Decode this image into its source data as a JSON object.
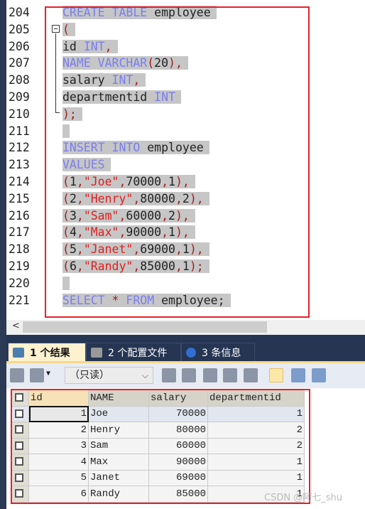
{
  "editor": {
    "lines": [
      {
        "n": "204",
        "tokens": [
          [
            "kw",
            "CREATE TABLE"
          ],
          [
            "tx",
            " employee"
          ]
        ]
      },
      {
        "n": "205",
        "tokens": [
          [
            "pn",
            "("
          ]
        ]
      },
      {
        "n": "206",
        "tokens": [
          [
            "tx",
            "id "
          ],
          [
            "kw",
            "INT"
          ],
          [
            "pn",
            ","
          ]
        ]
      },
      {
        "n": "207",
        "tokens": [
          [
            "kw",
            "NAME VARCHAR"
          ],
          [
            "pn",
            "("
          ],
          [
            "tx",
            "20"
          ],
          [
            "pn",
            "),"
          ]
        ]
      },
      {
        "n": "208",
        "tokens": [
          [
            "tx",
            "salary "
          ],
          [
            "kw",
            "INT"
          ],
          [
            "pn",
            ","
          ]
        ]
      },
      {
        "n": "209",
        "tokens": [
          [
            "tx",
            "departmentid "
          ],
          [
            "kw",
            "INT"
          ]
        ]
      },
      {
        "n": "210",
        "tokens": [
          [
            "pn",
            ");"
          ]
        ]
      },
      {
        "n": "211",
        "tokens": []
      },
      {
        "n": "212",
        "tokens": [
          [
            "kw",
            "INSERT INTO"
          ],
          [
            "tx",
            " employee"
          ]
        ]
      },
      {
        "n": "213",
        "tokens": [
          [
            "kw",
            "VALUES"
          ]
        ]
      },
      {
        "n": "214",
        "tokens": [
          [
            "pn",
            "("
          ],
          [
            "tx",
            "1"
          ],
          [
            "pn",
            ","
          ],
          [
            "str",
            "\"Joe\""
          ],
          [
            "pn",
            ","
          ],
          [
            "tx",
            "70000"
          ],
          [
            "pn",
            ","
          ],
          [
            "tx",
            "1"
          ],
          [
            "pn",
            "),"
          ]
        ]
      },
      {
        "n": "215",
        "tokens": [
          [
            "pn",
            "("
          ],
          [
            "tx",
            "2"
          ],
          [
            "pn",
            ","
          ],
          [
            "str",
            "\"Henry\""
          ],
          [
            "pn",
            ","
          ],
          [
            "tx",
            "80000"
          ],
          [
            "pn",
            ","
          ],
          [
            "tx",
            "2"
          ],
          [
            "pn",
            "),"
          ]
        ]
      },
      {
        "n": "216",
        "tokens": [
          [
            "pn",
            "("
          ],
          [
            "tx",
            "3"
          ],
          [
            "pn",
            ","
          ],
          [
            "str",
            "\"Sam\""
          ],
          [
            "pn",
            ","
          ],
          [
            "tx",
            "60000"
          ],
          [
            "pn",
            ","
          ],
          [
            "tx",
            "2"
          ],
          [
            "pn",
            "),"
          ]
        ]
      },
      {
        "n": "217",
        "tokens": [
          [
            "pn",
            "("
          ],
          [
            "tx",
            "4"
          ],
          [
            "pn",
            ","
          ],
          [
            "str",
            "\"Max\""
          ],
          [
            "pn",
            ","
          ],
          [
            "tx",
            "90000"
          ],
          [
            "pn",
            ","
          ],
          [
            "tx",
            "1"
          ],
          [
            "pn",
            "),"
          ]
        ]
      },
      {
        "n": "218",
        "tokens": [
          [
            "pn",
            "("
          ],
          [
            "tx",
            "5"
          ],
          [
            "pn",
            ","
          ],
          [
            "str",
            "\"Janet\""
          ],
          [
            "pn",
            ","
          ],
          [
            "tx",
            "69000"
          ],
          [
            "pn",
            ","
          ],
          [
            "tx",
            "1"
          ],
          [
            "pn",
            "),"
          ]
        ]
      },
      {
        "n": "219",
        "tokens": [
          [
            "pn",
            "("
          ],
          [
            "tx",
            "6"
          ],
          [
            "pn",
            ","
          ],
          [
            "str",
            "\"Randy\""
          ],
          [
            "pn",
            ","
          ],
          [
            "tx",
            "85000"
          ],
          [
            "pn",
            ","
          ],
          [
            "tx",
            "1"
          ],
          [
            "pn",
            ");"
          ]
        ]
      },
      {
        "n": "220",
        "tokens": []
      },
      {
        "n": "221",
        "tokens": [
          [
            "kw",
            "SELECT"
          ],
          [
            "tx",
            " "
          ],
          [
            "pn",
            "*"
          ],
          [
            "tx",
            " "
          ],
          [
            "kw",
            "FROM"
          ],
          [
            "tx",
            " employee;"
          ]
        ]
      }
    ]
  },
  "tabs": [
    {
      "label": "1 个结果",
      "icon": "result-grid-icon",
      "active": true
    },
    {
      "label": "2 个配置文件",
      "icon": "profile-icon",
      "active": false
    },
    {
      "label": "3 条信息",
      "icon": "info-icon",
      "active": false
    }
  ],
  "toolbar": {
    "mode_select": "（只读）"
  },
  "grid": {
    "columns": [
      "id",
      "NAME",
      "salary",
      "departmentid"
    ],
    "rows": [
      [
        "1",
        "Joe",
        "70000",
        "1"
      ],
      [
        "2",
        "Henry",
        "80000",
        "2"
      ],
      [
        "3",
        "Sam",
        "60000",
        "2"
      ],
      [
        "4",
        "Max",
        "90000",
        "1"
      ],
      [
        "5",
        "Janet",
        "69000",
        "1"
      ],
      [
        "6",
        "Randy",
        "85000",
        "1"
      ]
    ]
  },
  "watermark": "CSDN @阿七_shu",
  "colors": {
    "keyword": "#7a7ef0",
    "string": "#e02020",
    "highlight_box": "#e8202a"
  }
}
